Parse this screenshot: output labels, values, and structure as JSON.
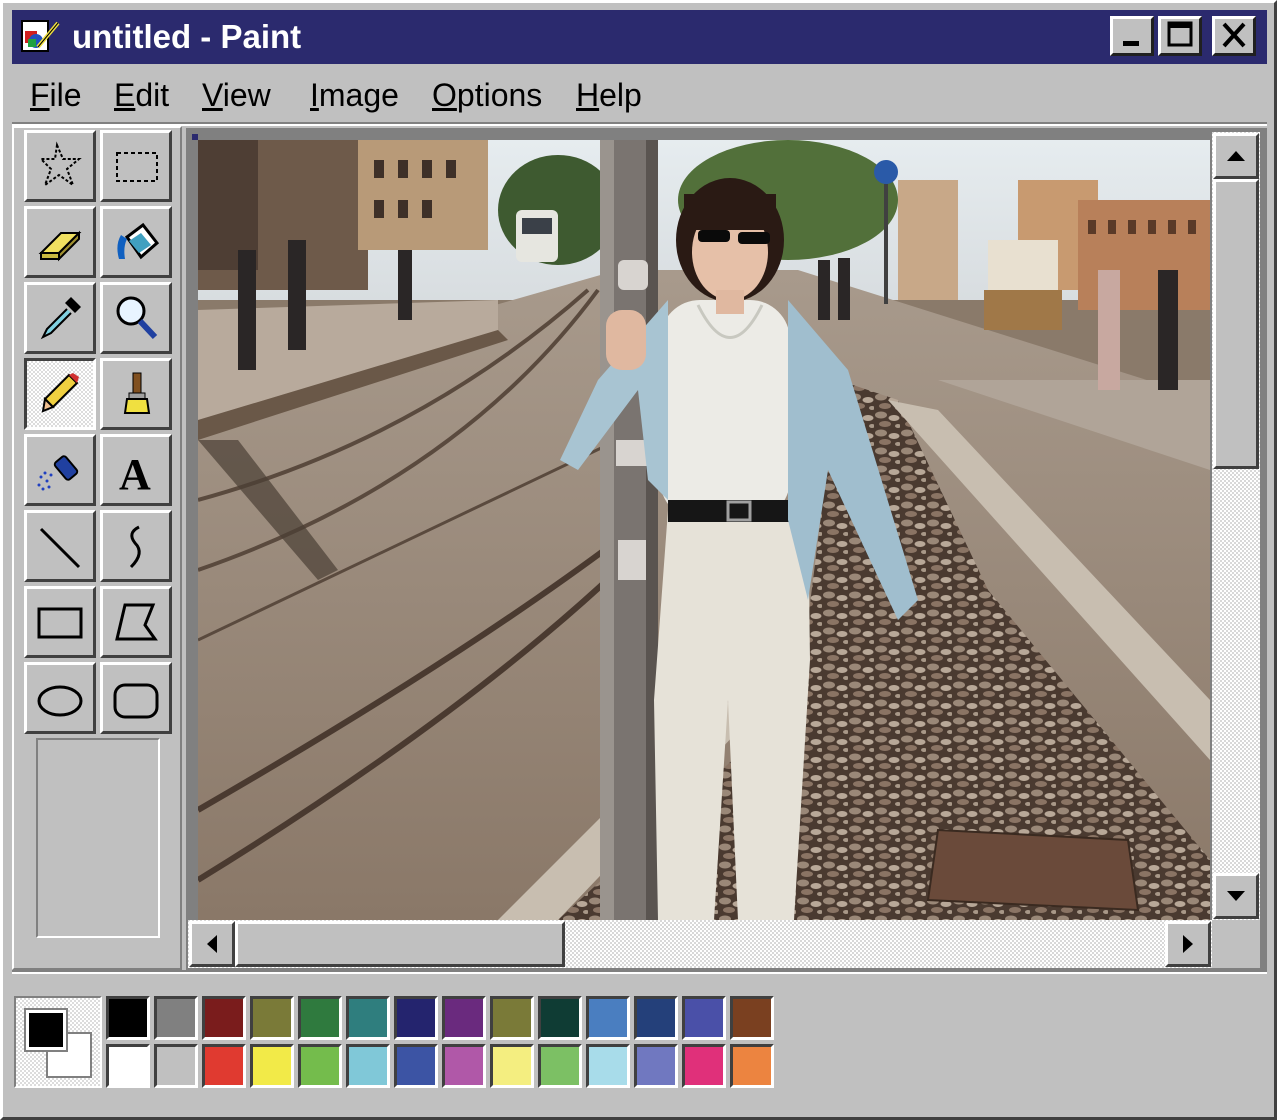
{
  "window": {
    "title": "untitled - Paint",
    "controls": [
      "minimize",
      "maximize",
      "close"
    ]
  },
  "menu": [
    {
      "key": "F",
      "rest": "ile"
    },
    {
      "key": "E",
      "rest": "dit"
    },
    {
      "key": "V",
      "rest": "iew"
    },
    {
      "key": "I",
      "rest": "mage"
    },
    {
      "key": "O",
      "rest": "ptions"
    },
    {
      "key": "H",
      "rest": "elp"
    }
  ],
  "tools": [
    {
      "name": "free-form-select",
      "icon": "free-form-select-icon",
      "active": false
    },
    {
      "name": "select",
      "icon": "rectangle-select-icon",
      "active": false
    },
    {
      "name": "eraser",
      "icon": "eraser-icon",
      "active": false
    },
    {
      "name": "fill-with-color",
      "icon": "paint-bucket-icon",
      "active": false
    },
    {
      "name": "pick-color",
      "icon": "eyedropper-icon",
      "active": false
    },
    {
      "name": "magnifier",
      "icon": "magnifier-icon",
      "active": false
    },
    {
      "name": "pencil",
      "icon": "pencil-icon",
      "active": true
    },
    {
      "name": "brush",
      "icon": "brush-icon",
      "active": false
    },
    {
      "name": "airbrush",
      "icon": "airbrush-icon",
      "active": false
    },
    {
      "name": "text",
      "icon": "text-icon",
      "active": false
    },
    {
      "name": "line",
      "icon": "line-icon",
      "active": false
    },
    {
      "name": "curve",
      "icon": "curve-icon",
      "active": false
    },
    {
      "name": "rectangle",
      "icon": "rectangle-icon",
      "active": false
    },
    {
      "name": "polygon",
      "icon": "polygon-icon",
      "active": false
    },
    {
      "name": "ellipse",
      "icon": "ellipse-icon",
      "active": false
    },
    {
      "name": "rounded-rectangle",
      "icon": "rounded-rectangle-icon",
      "active": false
    }
  ],
  "canvas": {
    "image_subject": "photo-of-woman-leaning-on-pole-by-tram-tracks"
  },
  "scrollbars": {
    "vertical_position": 0.0,
    "horizontal_position": 0.0
  },
  "colors": {
    "foreground": "#000000",
    "background": "#ffffff",
    "titlebar": "#2b2a6e",
    "palette_top": [
      "#000000",
      "#808080",
      "#7a1c1c",
      "#7a7a38",
      "#2f7a3e",
      "#2f7e7e",
      "#24246e",
      "#6a2a7e",
      "#7a7a38",
      "#0f3c34",
      "#4a7ec0",
      "#24407a",
      "#4a50a8",
      "#7a4020"
    ],
    "palette_bottom": [
      "#ffffff",
      "#c0c0c0",
      "#e03a30",
      "#f2ea48",
      "#74bc4c",
      "#80c8d8",
      "#3c54a4",
      "#b058a8",
      "#f4ee80",
      "#7cc064",
      "#a8dcea",
      "#7078c0",
      "#e0307a",
      "#ec8440"
    ]
  }
}
